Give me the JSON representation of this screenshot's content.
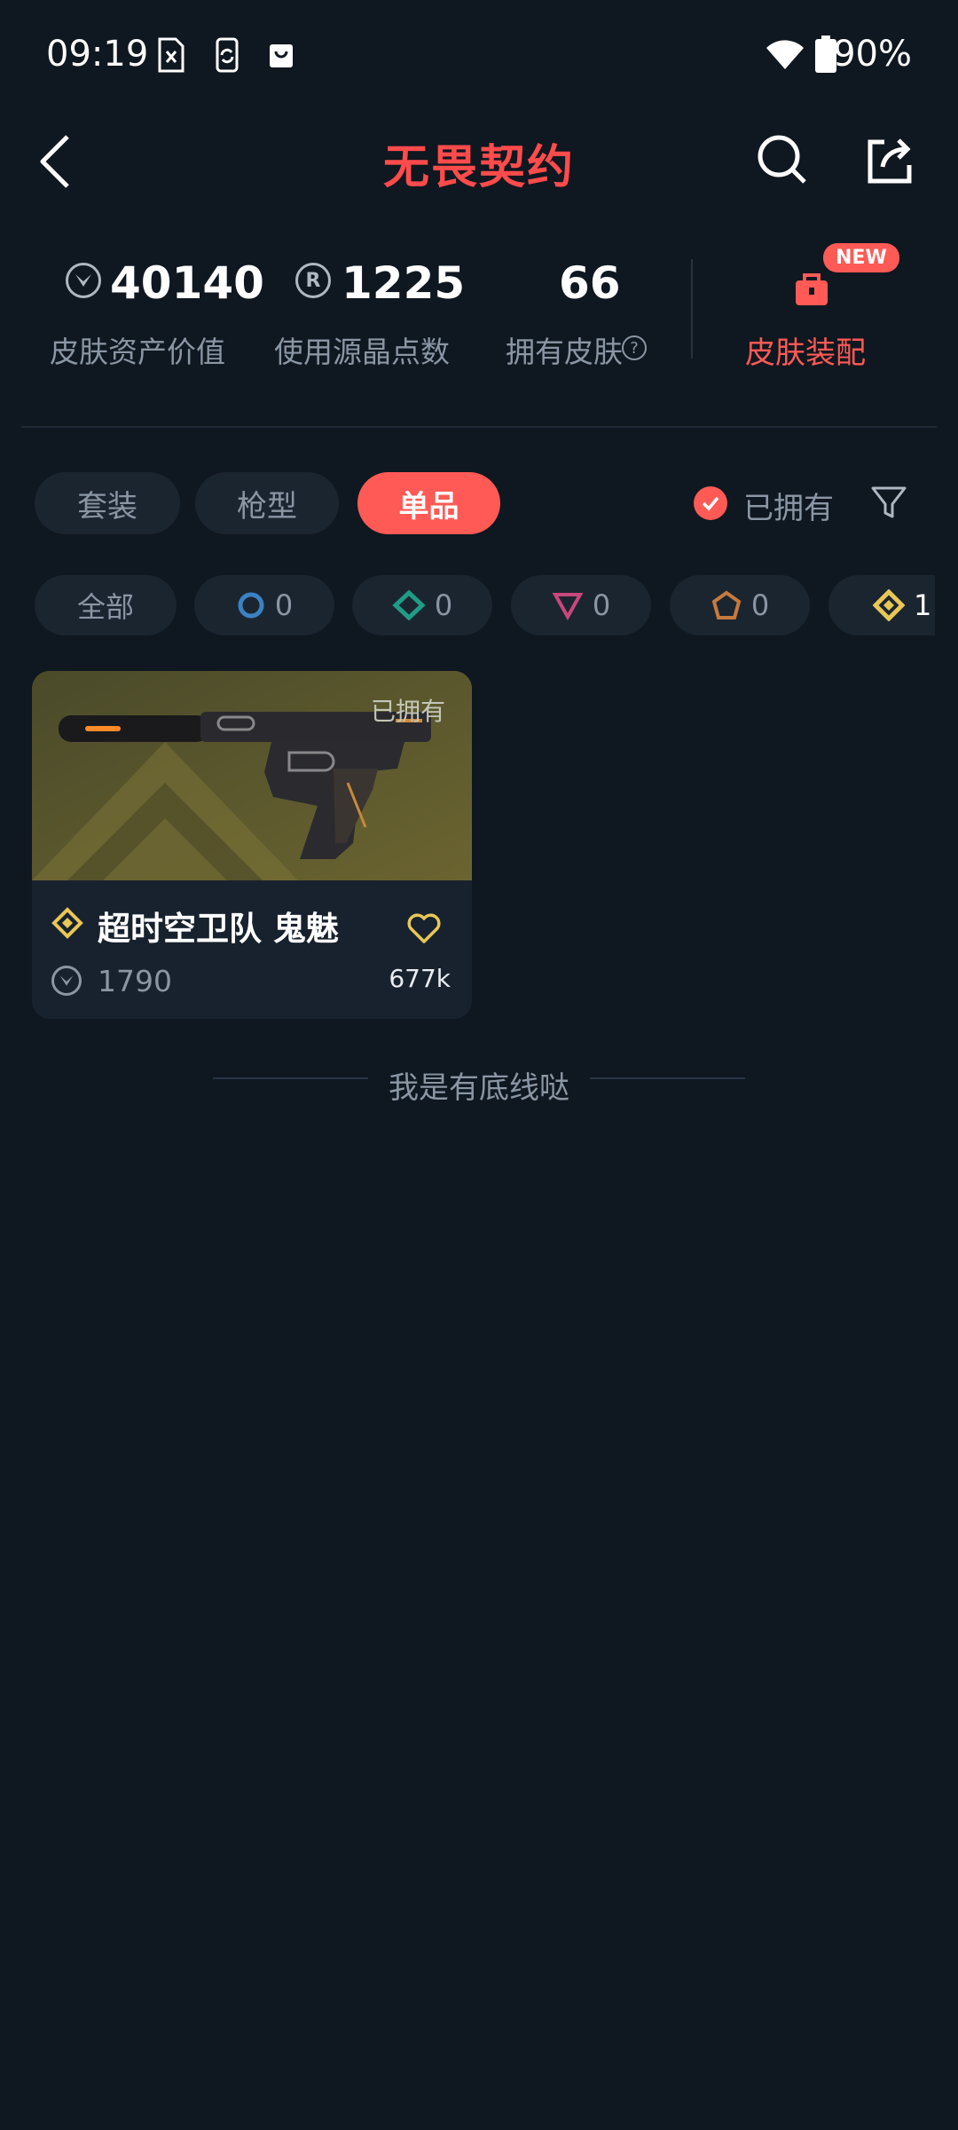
{
  "status": {
    "time": "09:19",
    "battery": "90%"
  },
  "header": {
    "title": "无畏契约",
    "icons": [
      "back-icon",
      "search-icon",
      "share-icon"
    ],
    "accent": "#ff4b4b"
  },
  "stats": {
    "asset_value": "40140",
    "asset_label": "皮肤资产价值",
    "points": "1225",
    "points_label": "使用源晶点数",
    "skins": "66",
    "skins_label": "拥有皮肤",
    "help_glyph": "?",
    "outfit_label": "皮肤装配",
    "new_badge": "NEW"
  },
  "tabs": [
    {
      "label": "套装"
    },
    {
      "label": "枪型"
    },
    {
      "label": "单品"
    }
  ],
  "filters": {
    "owned_label": "已拥有"
  },
  "chips": {
    "all_label": "全部",
    "tiers": [
      {
        "count": "0",
        "color": "#3b82c4"
      },
      {
        "count": "0",
        "color": "#1f9c85"
      },
      {
        "count": "0",
        "color": "#c8477d"
      },
      {
        "count": "0",
        "color": "#c67a3d"
      },
      {
        "count": "1",
        "color": "#e8c755"
      }
    ]
  },
  "card": {
    "owned_tag": "已拥有",
    "title": "超时空卫队 鬼魅",
    "price": "1790",
    "likes": "677k"
  },
  "footer": {
    "end_text": "我是有底线哒"
  }
}
